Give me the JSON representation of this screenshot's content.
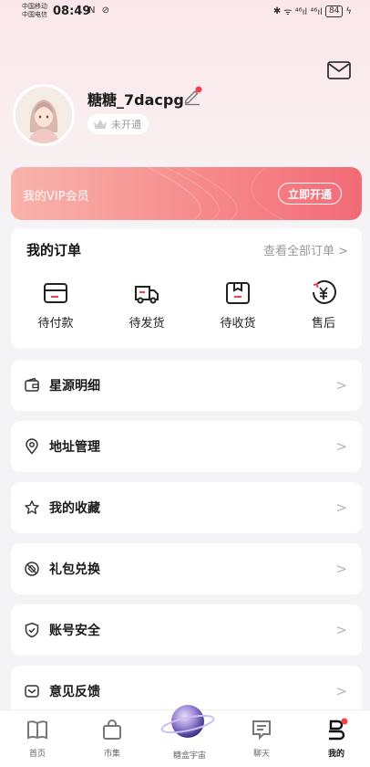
{
  "status_bar": {
    "carrier1": "中国移动",
    "carrier2": "中国电信",
    "time": "08:49",
    "notif_icons": "N ⊘",
    "signal": "ᯤ ⁴⁶ıl ⁴⁶ıl",
    "battery": "84"
  },
  "profile": {
    "username": "糖糖_7dacpg",
    "member_status": "未开通"
  },
  "vip": {
    "label": "我的VIP会员",
    "button": "立即开通"
  },
  "orders": {
    "title": "我的订单",
    "view_all": "查看全部订单 >",
    "items": [
      {
        "label": "待付款",
        "icon": "wallet-card-icon"
      },
      {
        "label": "待发货",
        "icon": "delivery-truck-icon"
      },
      {
        "label": "待收货",
        "icon": "package-box-icon"
      },
      {
        "label": "售后",
        "icon": "yuan-refund-icon"
      }
    ]
  },
  "menu": [
    {
      "label": "星源明细",
      "icon": "wallet-icon"
    },
    {
      "label": "地址管理",
      "icon": "location-pin-icon"
    },
    {
      "label": "我的收藏",
      "icon": "star-icon"
    },
    {
      "label": "礼包兑换",
      "icon": "ticket-icon"
    },
    {
      "label": "账号安全",
      "icon": "shield-icon"
    },
    {
      "label": "意见反馈",
      "icon": "feedback-icon"
    }
  ],
  "chevron": ">",
  "tabbar": [
    {
      "label": "首页",
      "icon": "book-icon"
    },
    {
      "label": "市集",
      "icon": "shopping-bag-icon"
    },
    {
      "label": "糖盒宇宙",
      "icon": "planet-icon"
    },
    {
      "label": "聊天",
      "icon": "chat-icon"
    },
    {
      "label": "我的",
      "icon": "profile-icon"
    }
  ],
  "colors": {
    "accent": "#f26b77",
    "vip_start": "#f9b4ac",
    "dot_red": "#f2404f"
  }
}
